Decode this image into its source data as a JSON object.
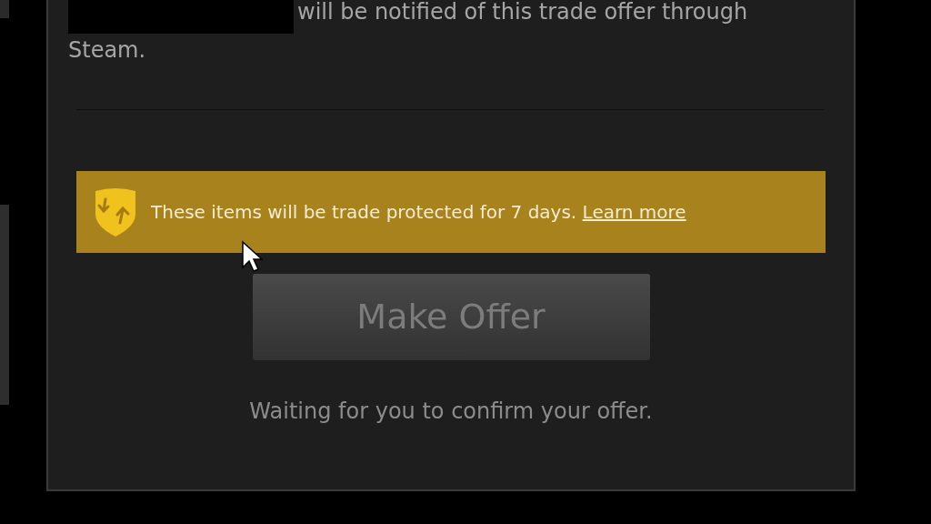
{
  "dialog": {
    "notice": "will be notified of this trade offer through Steam.",
    "protection_banner": {
      "text": "These items will be trade protected for 7 days.",
      "link": "Learn more"
    },
    "make_offer_button": {
      "label": "Make Offer",
      "disabled": true
    },
    "status": "Waiting for you to confirm your offer."
  }
}
